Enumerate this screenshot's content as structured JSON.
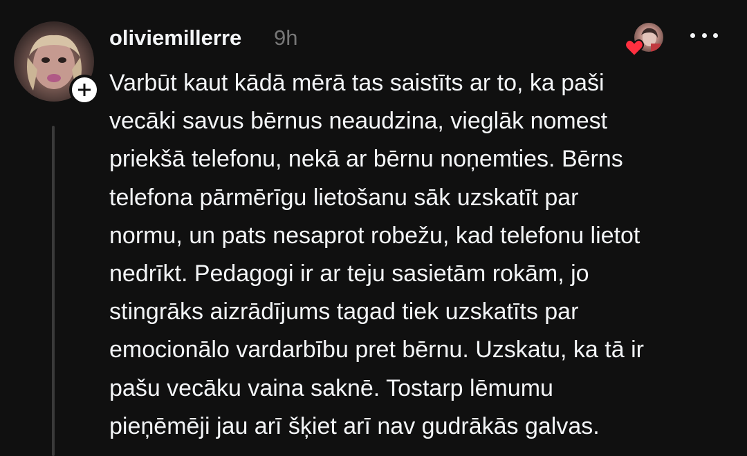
{
  "post": {
    "username": "oliviemillerre",
    "timestamp": "9h",
    "text_lines": [
      "Varbūt kaut kādā mērā tas saistīts ar to, ka paši",
      "vecāki savus bērnus neaudzina, vieglāk nomest",
      "priekšā telefonu, nekā ar bērnu noņemties. Bērns",
      "telefona pārmērīgu lietošanu sāk uzskatīt par",
      "normu, un pats nesaprot robežu, kad telefonu lietot",
      "nedrīkt. Pedagogi ir ar teju sasietām rokām, jo",
      "stingrāks aizrādījums tagad tiek uzskatīts par",
      "emocionālo vardarbību pret bērnu. Uzskatu, ka tā ir",
      "pašu vecāku vaina saknē. Tostarp lēmumu",
      "pieņēmēji jau arī šķiet arī nav gudrākās galvas."
    ]
  },
  "icons": {
    "follow": "plus-icon",
    "like": "heart-icon",
    "menu": "more-horizontal-icon"
  },
  "colors": {
    "background": "#101010",
    "text_primary": "#f3f5f7",
    "text_secondary": "#777777",
    "heart": "#ff3040",
    "thread_line": "#3a3a3a"
  }
}
